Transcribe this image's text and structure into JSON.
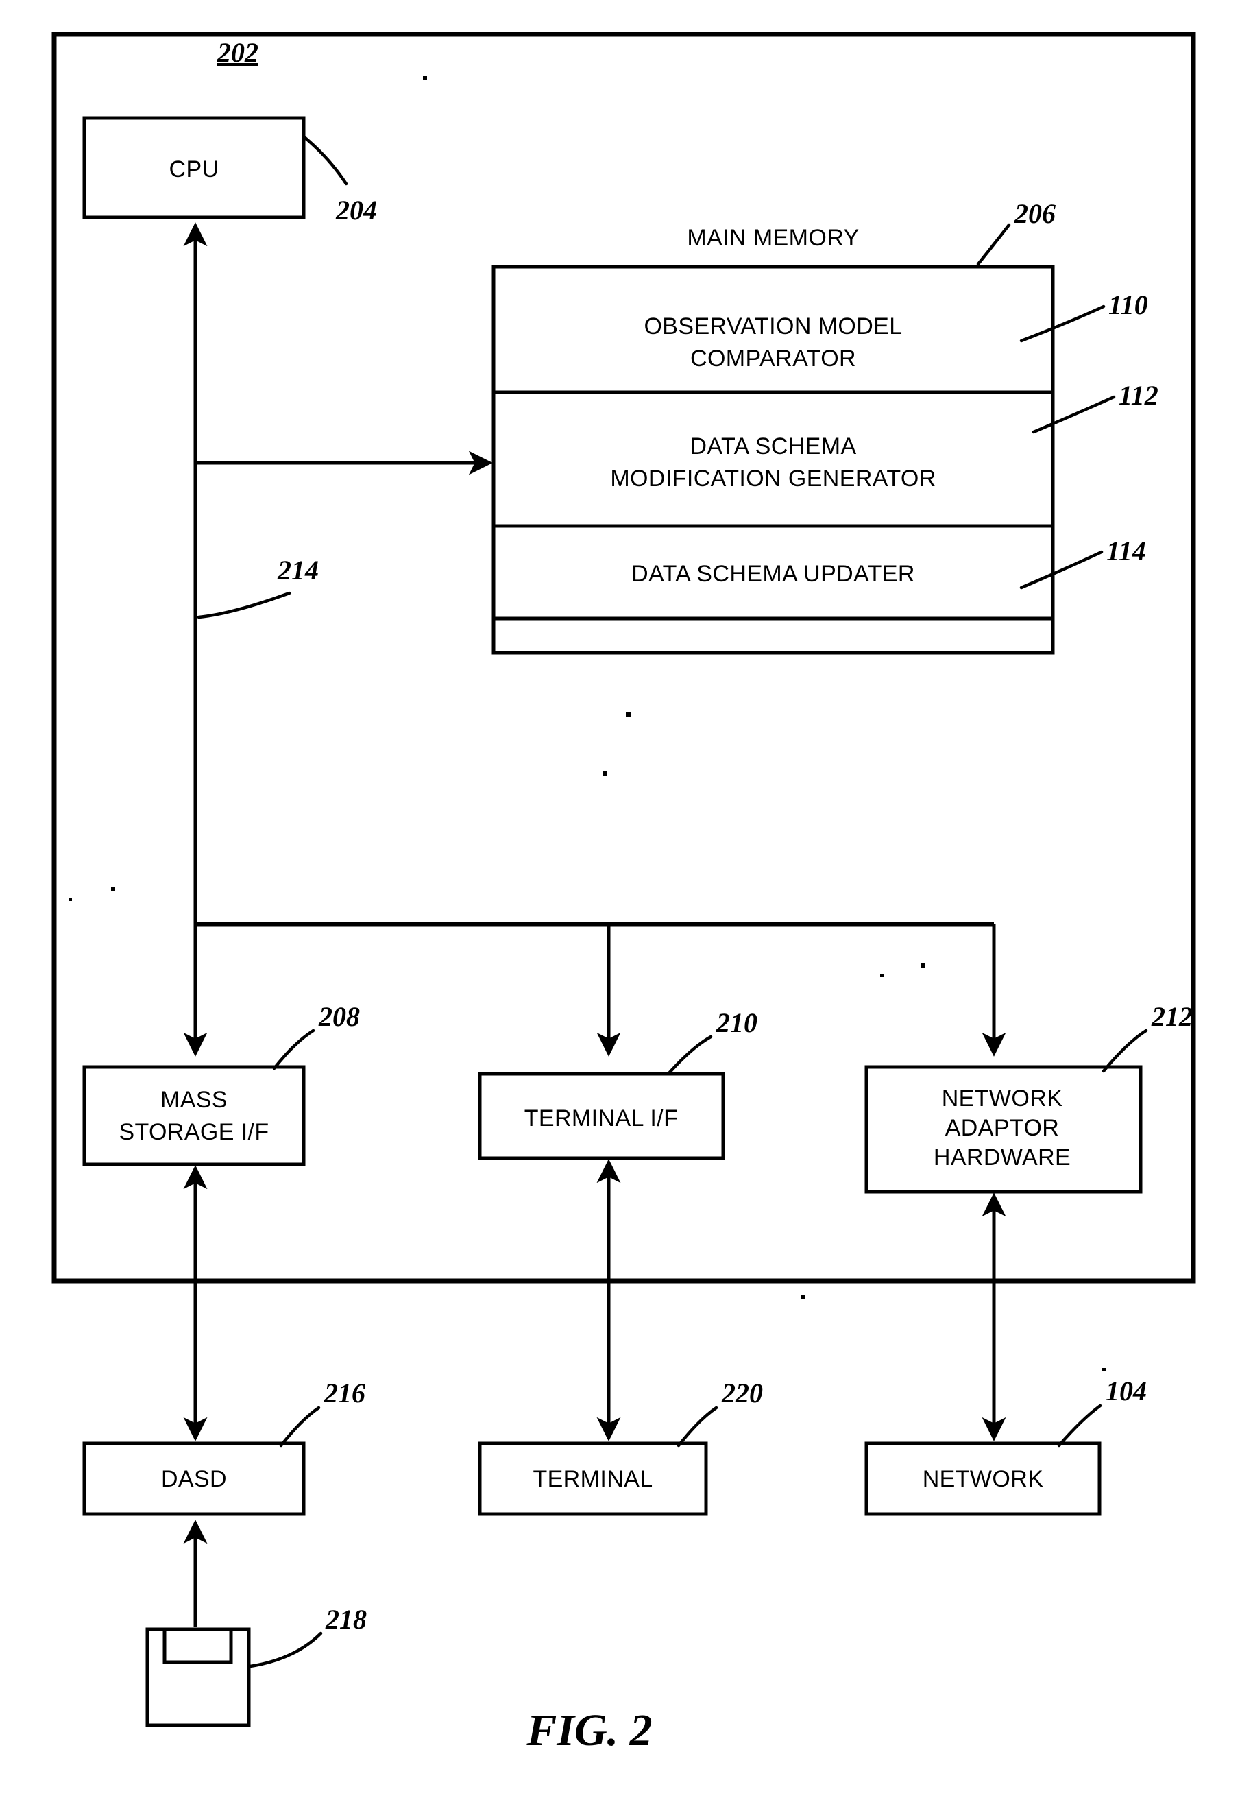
{
  "figure": {
    "caption": "FIG. 2",
    "system_ref": "202"
  },
  "blocks": {
    "cpu": {
      "label": "CPU",
      "ref": "204"
    },
    "main_memory": {
      "title": "MAIN MEMORY",
      "ref": "206"
    },
    "memory_modules": [
      {
        "label_line1": "OBSERVATION MODEL",
        "label_line2": "COMPARATOR",
        "ref": "110"
      },
      {
        "label_line1": "DATA SCHEMA",
        "label_line2": "MODIFICATION GENERATOR",
        "ref": "112"
      },
      {
        "label_line1": "DATA SCHEMA UPDATER",
        "label_line2": "",
        "ref": "114"
      }
    ],
    "bus": {
      "ref": "214"
    },
    "mass_storage_if": {
      "label_line1": "MASS",
      "label_line2": "STORAGE I/F",
      "ref": "208"
    },
    "terminal_if": {
      "label_line1": "TERMINAL I/F",
      "label_line2": "",
      "ref": "210"
    },
    "network_adaptor": {
      "label_line1": "NETWORK",
      "label_line2": "ADAPTOR",
      "label_line3": "HARDWARE",
      "ref": "212"
    },
    "dasd": {
      "label": "DASD",
      "ref": "216"
    },
    "terminal": {
      "label": "TERMINAL",
      "ref": "220"
    },
    "network": {
      "label": "NETWORK",
      "ref": "104"
    },
    "removable_media": {
      "label": "",
      "ref": "218"
    }
  },
  "colors": {
    "ink": "#000000",
    "paper": "#ffffff"
  }
}
